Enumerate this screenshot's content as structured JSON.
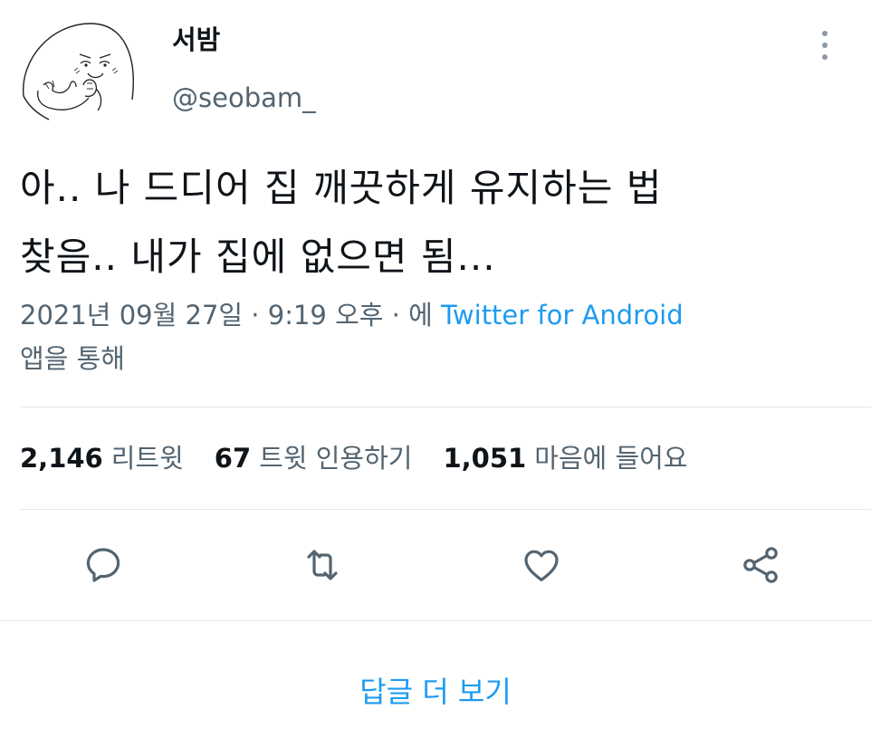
{
  "author": {
    "display_name": "서밤",
    "handle": "@seobam_"
  },
  "tweet": {
    "text_lines": [
      "아..  나 드디어 집 깨끗하게 유지하는 법",
      "찾음..  내가 집에 없으면 됨..."
    ],
    "timestamp": "2021년 09월 27일 · 9:19 오후 · 에",
    "source": "Twitter for Android",
    "source_suffix": "앱을 통해"
  },
  "stats": {
    "retweets": {
      "count": "2,146",
      "label": "리트윗"
    },
    "quotes": {
      "count": "67",
      "label": "트윗 인용하기"
    },
    "likes": {
      "count": "1,051",
      "label": "마음에 들어요"
    }
  },
  "actions": {
    "icons": [
      "reply-icon",
      "retweet-icon",
      "heart-icon",
      "share-icon"
    ]
  },
  "footer": {
    "more_replies_label": "답글 더 보기"
  },
  "colors": {
    "accent": "#1d9bf0",
    "secondary_text": "#536471",
    "primary_text": "#0f1419",
    "divider": "#e1e8ed"
  }
}
